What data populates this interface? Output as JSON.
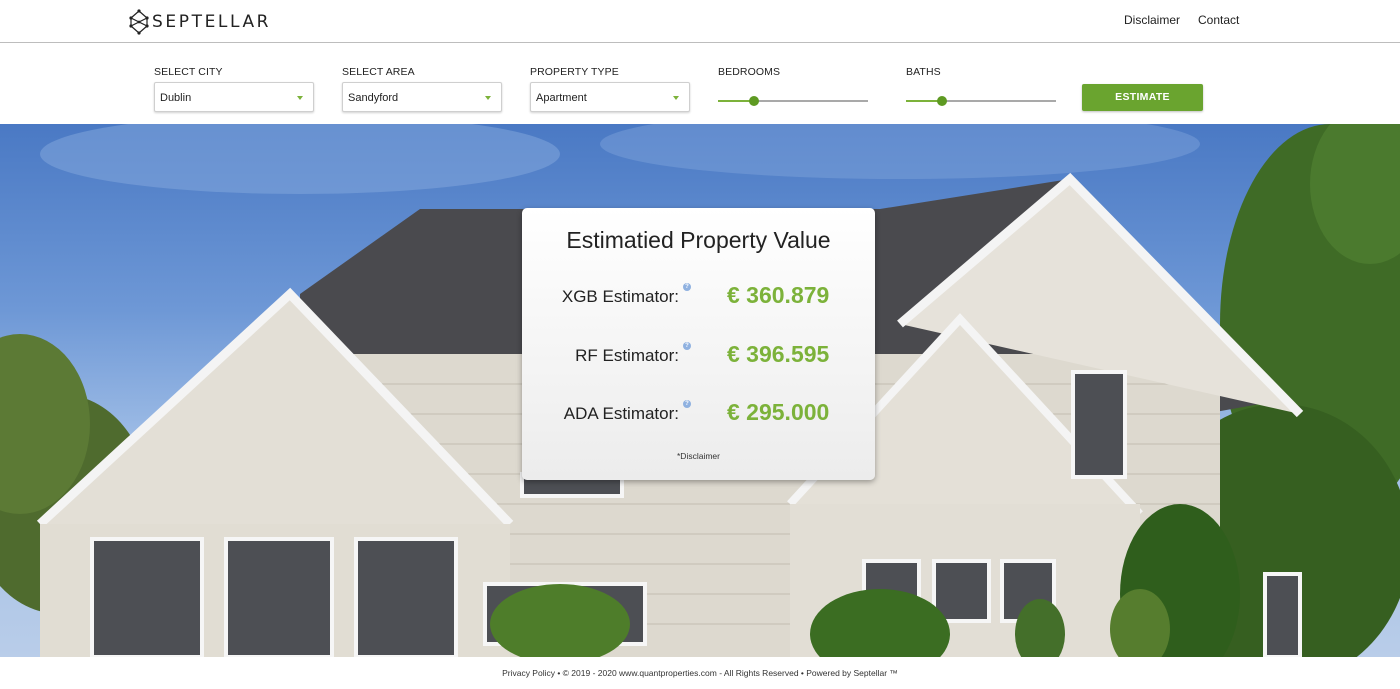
{
  "header": {
    "logo_text": "SEPTELLAR",
    "nav": {
      "disclaimer": "Disclaimer",
      "contact": "Contact"
    }
  },
  "filters": {
    "city": {
      "label": "SELECT CITY",
      "value": "Dublin"
    },
    "area": {
      "label": "SELECT AREA",
      "value": "Sandyford"
    },
    "property_type": {
      "label": "PROPERTY TYPE",
      "value": "Apartment"
    },
    "bedrooms": {
      "label": "BEDROOMS",
      "level": 0.24
    },
    "baths": {
      "label": "BATHS",
      "level": 0.24
    },
    "estimate_button": "ESTIMATE"
  },
  "result_card": {
    "title": "Estimatied Property Value",
    "estimators": [
      {
        "label": "XGB Estimator:",
        "value": "€ 360.879"
      },
      {
        "label": "RF Estimator:",
        "value": "€ 396.595"
      },
      {
        "label": "ADA Estimator:",
        "value": "€ 295.000"
      }
    ],
    "help_icon": "?",
    "disclaimer": "*Disclaimer"
  },
  "footer": {
    "text": "Privacy Policy • © 2019 - 2020 www.quantproperties.com - All Rights Reserved • Powered by Septellar ™"
  },
  "colors": {
    "accent": "#7cb23a",
    "button": "#6aa42f"
  }
}
